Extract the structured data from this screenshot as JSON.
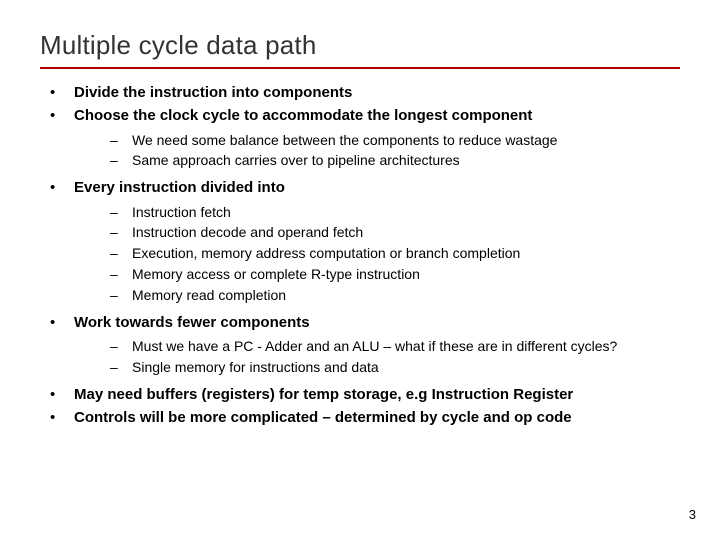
{
  "title": "Multiple cycle data path",
  "bullets": {
    "b0": "Divide the instruction into components",
    "b1": "Choose the clock cycle to accommodate the longest component",
    "b1_sub": {
      "s0": "We need some balance between the components to reduce wastage",
      "s1": "Same approach carries over to pipeline architectures"
    },
    "b2": "Every instruction divided into",
    "b2_sub": {
      "s0": "Instruction fetch",
      "s1": "Instruction decode and operand fetch",
      "s2": "Execution, memory address computation or branch completion",
      "s3": "Memory access or complete R-type instruction",
      "s4": "Memory read completion"
    },
    "b3": "Work towards fewer components",
    "b3_sub": {
      "s0": "Must we have a PC - Adder and an ALU – what if these are in different cycles?",
      "s1": "Single memory for instructions and data"
    },
    "b4": "May need buffers (registers) for temp storage, e.g Instruction Register",
    "b5": "Controls will be more complicated – determined by cycle and op code"
  },
  "page_number": "3",
  "colors": {
    "rule": "#b00000"
  }
}
